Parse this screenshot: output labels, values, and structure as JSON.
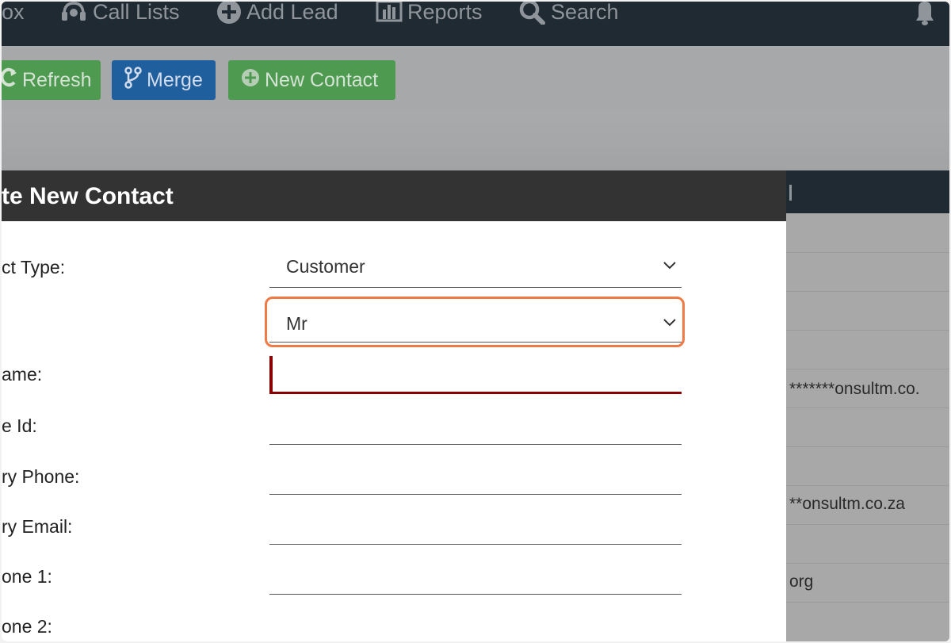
{
  "nav": {
    "items": [
      {
        "label": "ox",
        "icon": "inbox-icon"
      },
      {
        "label": "Call Lists",
        "icon": "headset-icon"
      },
      {
        "label": "Add Lead",
        "icon": "plus-circle-icon"
      },
      {
        "label": "Reports",
        "icon": "bar-chart-icon"
      },
      {
        "label": "Search",
        "icon": "search-icon"
      }
    ],
    "bell_icon": "bell-icon"
  },
  "toolbar": {
    "refresh_label": "Refresh",
    "merge_label": "Merge",
    "new_contact_label": "New Contact"
  },
  "background_table": {
    "rows": [
      "",
      "",
      "",
      "",
      "*******onsultm.co.",
      "",
      "",
      "**onsultm.co.za",
      "",
      "org",
      ""
    ]
  },
  "modal": {
    "title": "te New Contact",
    "fields": {
      "contact_type": {
        "label": "ct Type:",
        "value": "Customer"
      },
      "title": {
        "label": "",
        "value": "Mr"
      },
      "name": {
        "label": "ame:",
        "value": ""
      },
      "id": {
        "label": "e Id:",
        "value": ""
      },
      "primary_phone": {
        "label": "ry Phone:",
        "value": ""
      },
      "primary_email": {
        "label": "ry Email:",
        "value": ""
      },
      "phone1": {
        "label": "one 1:",
        "value": ""
      },
      "phone2": {
        "label": "one 2:",
        "value": ""
      }
    }
  },
  "colors": {
    "nav_bg": "#1f2a33",
    "green_button": "#4e9a50",
    "blue_button": "#1f5f9e",
    "highlight": "#f07a45",
    "invalid": "#8b0000"
  }
}
